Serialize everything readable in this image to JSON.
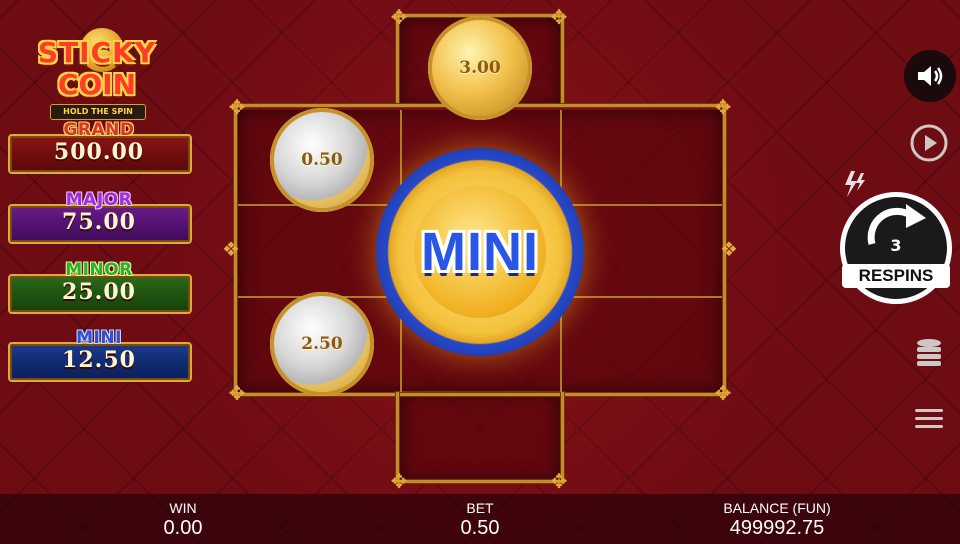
{
  "logo": {
    "line1": "STICKY",
    "line2": "COIN",
    "tagline": "HOLD THE SPIN"
  },
  "jackpots": [
    {
      "name": "GRAND",
      "value": "500.00"
    },
    {
      "name": "MAJOR",
      "value": "75.00"
    },
    {
      "name": "MINOR",
      "value": "25.00"
    },
    {
      "name": "MINI",
      "value": "12.50"
    }
  ],
  "grid": {
    "coins": [
      {
        "value": "3.00",
        "type": "gold"
      },
      {
        "value": "0.50",
        "type": "silver"
      },
      {
        "value": "2.50",
        "type": "silver"
      }
    ],
    "feature_coin": {
      "label": "MINI"
    }
  },
  "controls": {
    "sound_icon": "speaker-icon",
    "autoplay_icon": "play-circle-icon",
    "turbo_icon": "lightning-icon",
    "respins_count": "3",
    "respins_label": "RESPINS",
    "bet_icon": "coin-stack-icon",
    "menu_icon": "hamburger-menu-icon"
  },
  "footer": {
    "win_label": "WIN",
    "win_value": "0.00",
    "bet_label": "BET",
    "bet_value": "0.50",
    "balance_label": "BALANCE (FUN)",
    "balance_value": "499992.75"
  },
  "colors": {
    "background": "#6e0c14",
    "frame_gold": "#c88a2a",
    "mini_blue": "#2a56e8"
  }
}
